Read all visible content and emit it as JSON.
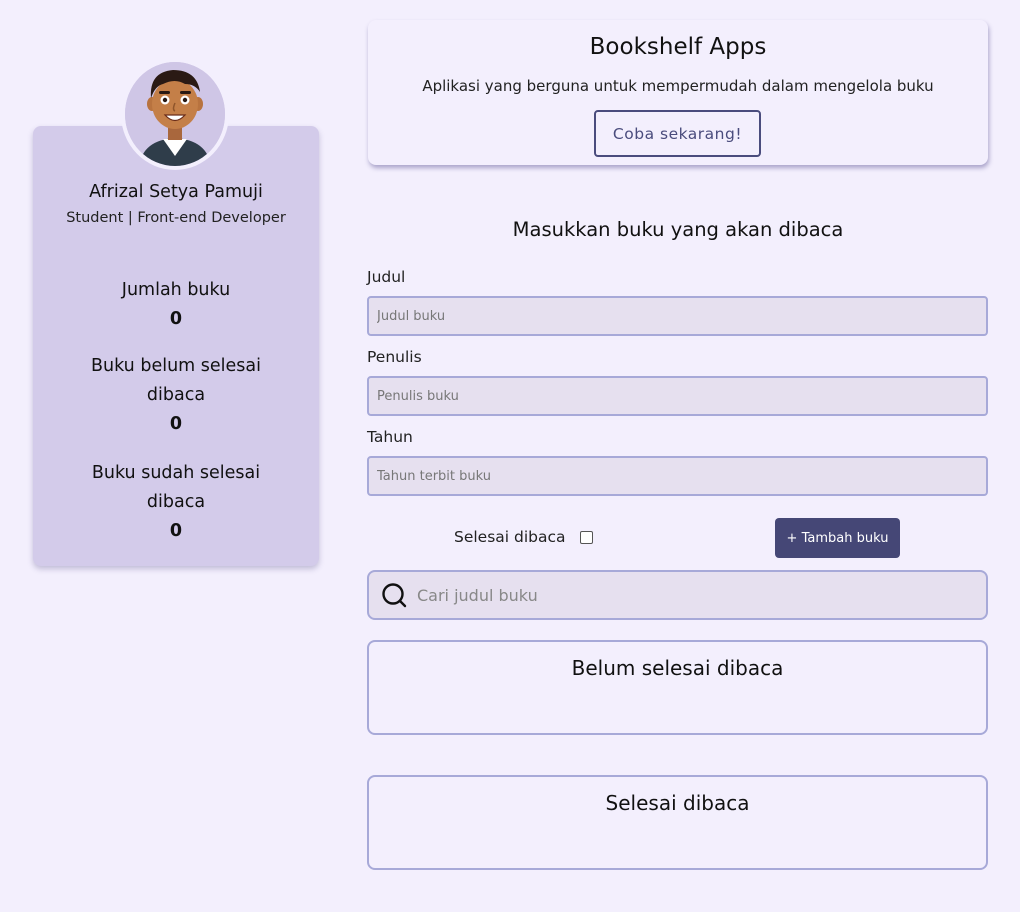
{
  "profile": {
    "name": "Afrizal Setya Pamuji",
    "role": "Student | Front-end Developer",
    "avatar_icon": "developer-avatar",
    "stats": [
      {
        "label": "Jumlah buku",
        "value": "0"
      },
      {
        "label": "Buku belum selesai dibaca",
        "value": "0"
      },
      {
        "label": "Buku sudah selesai dibaca",
        "value": "0"
      }
    ]
  },
  "hero": {
    "title": "Bookshelf Apps",
    "description": "Aplikasi yang berguna untuk mempermudah dalam mengelola buku",
    "cta_label": "Coba sekarang!"
  },
  "form": {
    "title": "Masukkan buku yang akan dibaca",
    "fields": [
      {
        "label": "Judul",
        "placeholder": "Judul buku",
        "value": ""
      },
      {
        "label": "Penulis",
        "placeholder": "Penulis buku",
        "value": ""
      },
      {
        "label": "Tahun",
        "placeholder": "Tahun terbit buku",
        "value": ""
      }
    ],
    "checkbox_label": "Selesai dibaca",
    "checkbox_checked": false,
    "add_button_label": "+ Tambah buku"
  },
  "search": {
    "placeholder": "Cari judul buku",
    "icon": "search-icon"
  },
  "shelves": {
    "unread_title": "Belum selesai dibaca",
    "read_title": "Selesai dibaca"
  },
  "colors": {
    "background": "#f3effd",
    "card": "#d3cbea",
    "input_background": "#e6e0ef",
    "input_border": "#a7a9d8",
    "primary": "#454776"
  }
}
